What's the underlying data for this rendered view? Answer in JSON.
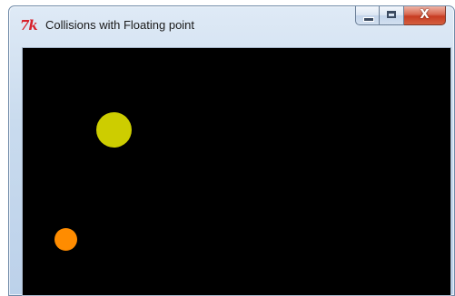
{
  "window": {
    "title": "Collisions with Floating point",
    "app_icon_glyph": "7k",
    "close_glyph": "X"
  },
  "canvas": {
    "background": "#000000",
    "balls": [
      {
        "name": "yellow-ball",
        "color": "#cdcd00"
      },
      {
        "name": "orange-ball",
        "color": "#ff8c00"
      }
    ]
  },
  "colors": {
    "titlebar": "#c9dbee",
    "close_button": "#c73c22",
    "app_icon": "#d8202a"
  }
}
